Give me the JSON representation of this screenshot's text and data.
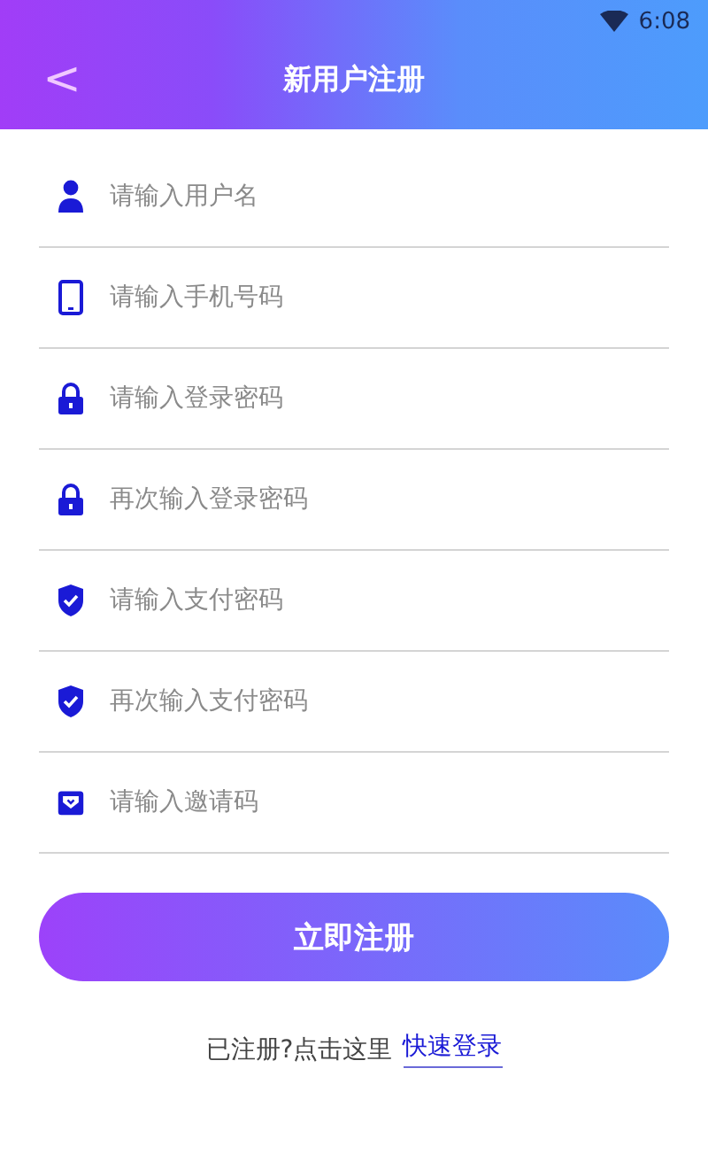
{
  "status_bar": {
    "time": "6:08"
  },
  "header": {
    "back": "<",
    "title": "新用户注册"
  },
  "fields": [
    {
      "kind": "user",
      "placeholder": "请输入用户名"
    },
    {
      "kind": "phone",
      "placeholder": "请输入手机号码"
    },
    {
      "kind": "lock",
      "placeholder": "请输入登录密码"
    },
    {
      "kind": "lock",
      "placeholder": "再次输入登录密码"
    },
    {
      "kind": "shield",
      "placeholder": "请输入支付密码"
    },
    {
      "kind": "shield",
      "placeholder": "再次输入支付密码"
    },
    {
      "kind": "invite",
      "placeholder": "请输入邀请码"
    }
  ],
  "submit": "立即注册",
  "footer": {
    "text": "已注册?点击这里",
    "link": "快速登录"
  }
}
